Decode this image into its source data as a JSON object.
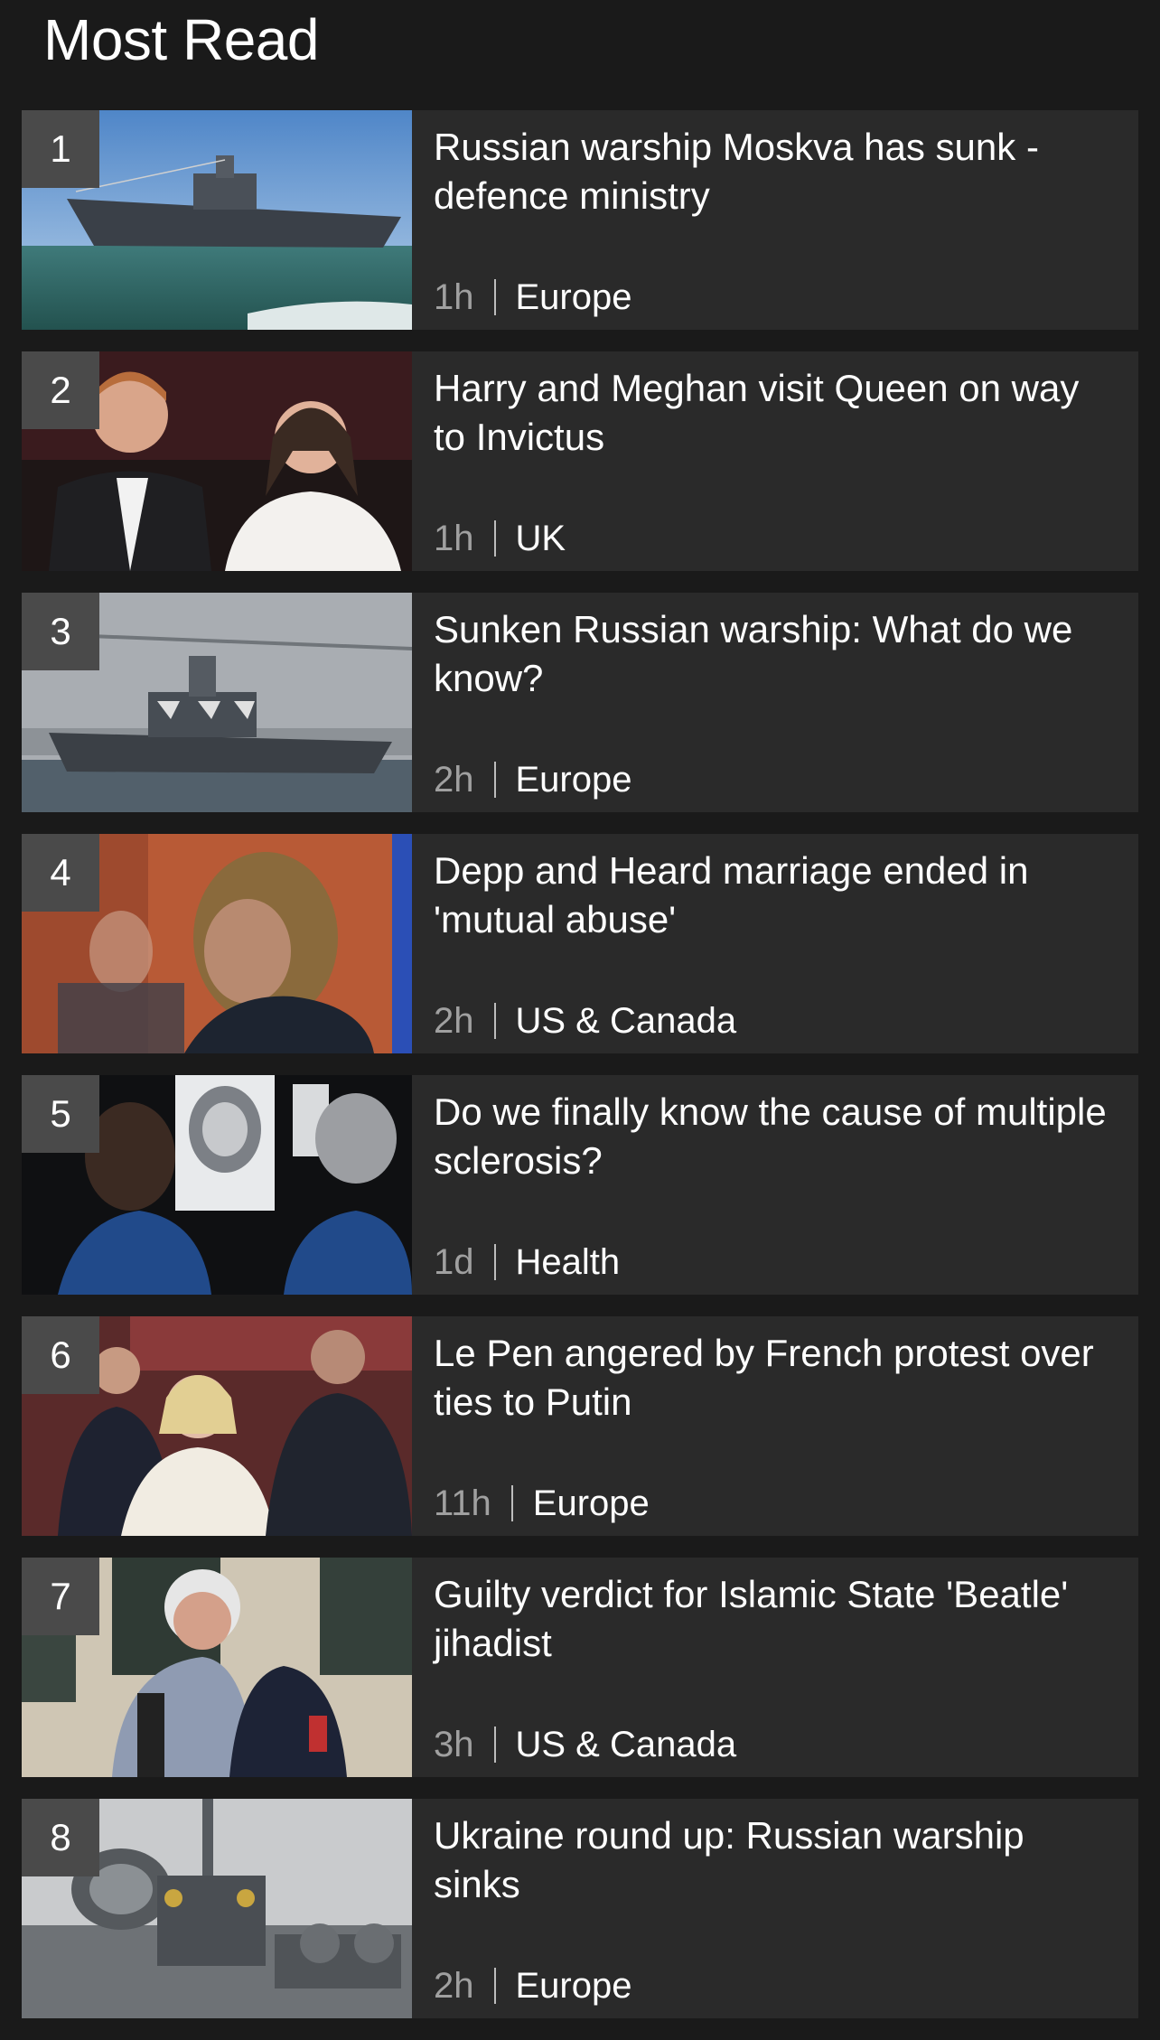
{
  "title": "Most Read",
  "items": [
    {
      "rank": "1",
      "headline": "Russian warship Moskva has sunk - defence ministry",
      "time": "1h",
      "section": "Europe",
      "image_icon": "warship-photo"
    },
    {
      "rank": "2",
      "headline": "Harry and Meghan visit Queen on way to Invictus",
      "time": "1h",
      "section": "UK",
      "image_icon": "royal-couple-photo"
    },
    {
      "rank": "3",
      "headline": "Sunken Russian warship: What do we know?",
      "time": "2h",
      "section": "Europe",
      "image_icon": "warship-bridge-photo"
    },
    {
      "rank": "4",
      "headline": "Depp and Heard marriage ended in 'mutual abuse'",
      "time": "2h",
      "section": "US & Canada",
      "image_icon": "courtroom-photo"
    },
    {
      "rank": "5",
      "headline": "Do we finally know the cause of multiple sclerosis?",
      "time": "1d",
      "section": "Health",
      "image_icon": "brain-scan-photo"
    },
    {
      "rank": "6",
      "headline": "Le Pen angered by French protest over ties to Putin",
      "time": "11h",
      "section": "Europe",
      "image_icon": "politician-crowd-photo"
    },
    {
      "rank": "7",
      "headline": "Guilty verdict for Islamic State 'Beatle' jihadist",
      "time": "3h",
      "section": "US & Canada",
      "image_icon": "embrace-photo"
    },
    {
      "rank": "8",
      "headline": "Ukraine round up: Russian warship sinks",
      "time": "2h",
      "section": "Europe",
      "image_icon": "ship-deck-photo"
    }
  ]
}
